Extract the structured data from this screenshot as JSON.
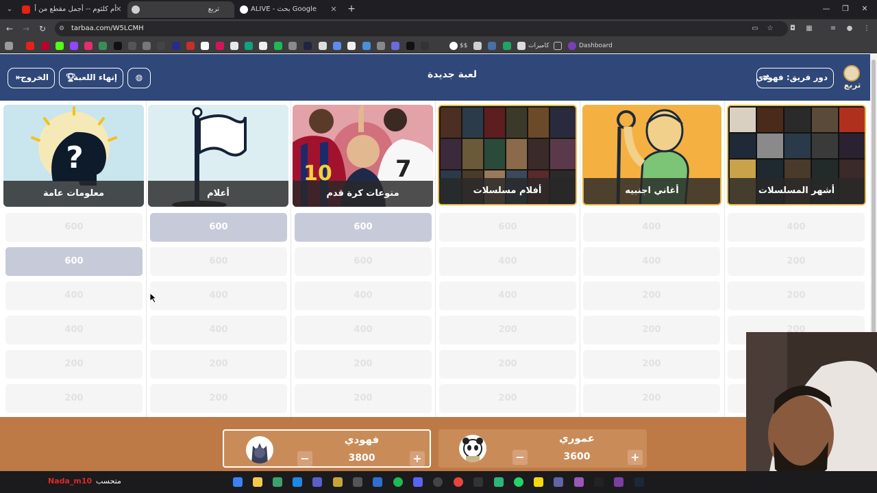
{
  "browser": {
    "tabs": [
      {
        "title": "أم كلثوم -- أجمل مقطع من أغنية",
        "active": false
      },
      {
        "title": "تربع",
        "active": true
      },
      {
        "title": "ALIVE - بحث Google",
        "active": false
      }
    ],
    "url": "tarbaa.com/W5LCMH",
    "bookmarks": {
      "cameras": "كاميرات",
      "dashboard": "Dashboard",
      "dollar": "$$"
    }
  },
  "header": {
    "logo_text": "تربع",
    "turn_label": "دور فريق: فهودي",
    "title": "لعبة جديدة",
    "end_game_label": "إنهاء اللعبة",
    "exit_label": "الخروج"
  },
  "categories": [
    {
      "label": "أشهر المسلسلات",
      "values": [
        "400",
        "200",
        "200",
        "200",
        "200",
        "200"
      ],
      "active": [
        false,
        false,
        false,
        false,
        false,
        false
      ]
    },
    {
      "label": "أغاني اجنبيه",
      "values": [
        "400",
        "400",
        "200",
        "200",
        "200",
        "200"
      ],
      "active": [
        false,
        false,
        false,
        false,
        false,
        false
      ]
    },
    {
      "label": "أفلام مسلسلات",
      "values": [
        "600",
        "400",
        "400",
        "200",
        "200",
        "200"
      ],
      "active": [
        false,
        false,
        false,
        false,
        false,
        false
      ]
    },
    {
      "label": "منوعات كرة قدم",
      "values": [
        "600",
        "600",
        "400",
        "400",
        "200",
        "200"
      ],
      "active": [
        true,
        false,
        false,
        false,
        false,
        false
      ]
    },
    {
      "label": "أعلام",
      "values": [
        "600",
        "600",
        "400",
        "400",
        "200",
        "200"
      ],
      "active": [
        true,
        false,
        false,
        false,
        false,
        false
      ]
    },
    {
      "label": "معلومات عامة",
      "values": [
        "600",
        "600",
        "400",
        "400",
        "200",
        "200"
      ],
      "active": [
        false,
        true,
        false,
        false,
        false,
        false
      ]
    }
  ],
  "teams": [
    {
      "name": "فهودي",
      "score": "3800",
      "current": true
    },
    {
      "name": "عموري",
      "score": "3600",
      "current": false
    }
  ],
  "taskbar": {
    "username": "Nada_m10",
    "text": "متحسب"
  },
  "colors": {
    "header_bg": "#2f4779",
    "footer_bg": "#bd7a46",
    "team_bg": "#c98c59",
    "active_tile": "#c7cad9"
  }
}
